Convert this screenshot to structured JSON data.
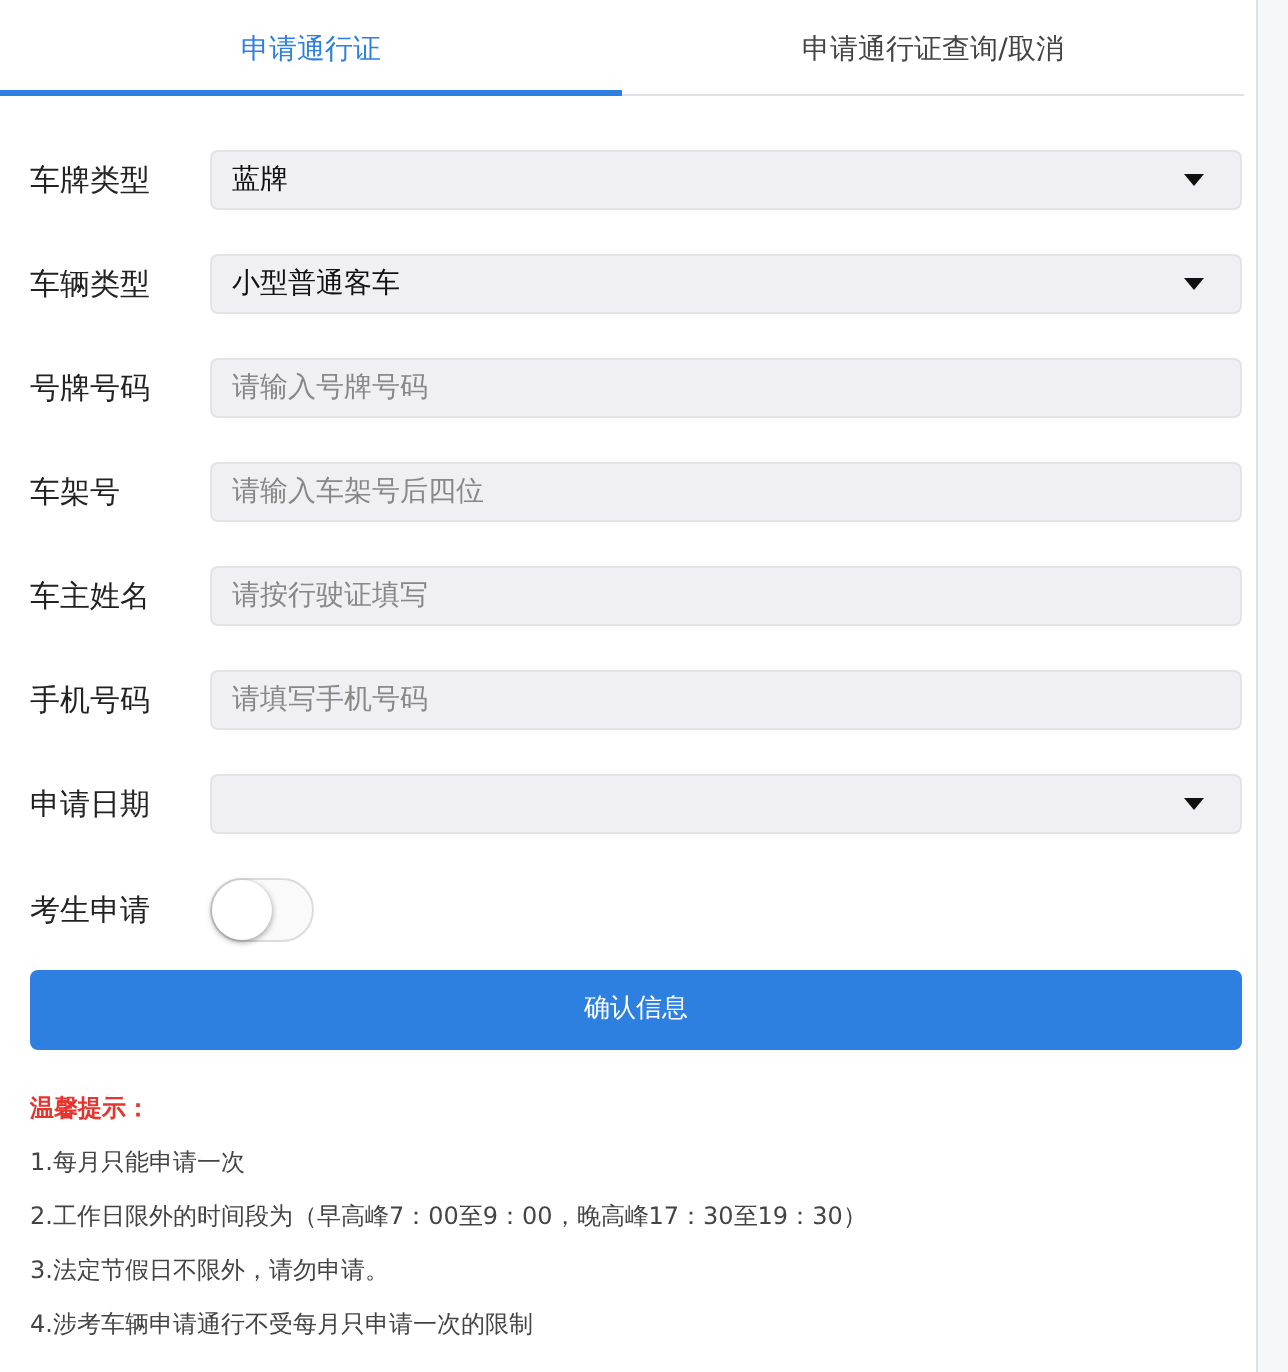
{
  "tabs": [
    {
      "label": "申请通行证",
      "selected": true
    },
    {
      "label": "申请通行证查询/取消",
      "selected": false
    }
  ],
  "form": [
    {
      "kind": "select",
      "label": "车牌类型",
      "value": "蓝牌"
    },
    {
      "kind": "select",
      "label": "车辆类型",
      "value": "小型普通客车"
    },
    {
      "kind": "input",
      "label": "号牌号码",
      "placeholder": "请输入号牌号码"
    },
    {
      "kind": "input",
      "label": "车架号",
      "placeholder": "请输入车架号后四位"
    },
    {
      "kind": "input",
      "label": "车主姓名",
      "placeholder": "请按行驶证填写"
    },
    {
      "kind": "input",
      "label": "手机号码",
      "placeholder": "请填写手机号码"
    },
    {
      "kind": "select",
      "label": "申请日期"
    },
    {
      "kind": "toggle",
      "label": "考生申请",
      "on": false
    }
  ],
  "submit_button": "确认信息",
  "tips": {
    "title": "温馨提示：",
    "items": [
      "1.每月只能申请一次",
      "2.工作日限外的时间段为（早高峰7：00至9：00，晚高峰17：30至19：30）",
      "3.法定节假日不限外，请勿申请。",
      "4.涉考车辆申请通行不受每月只申请一次的限制"
    ]
  }
}
